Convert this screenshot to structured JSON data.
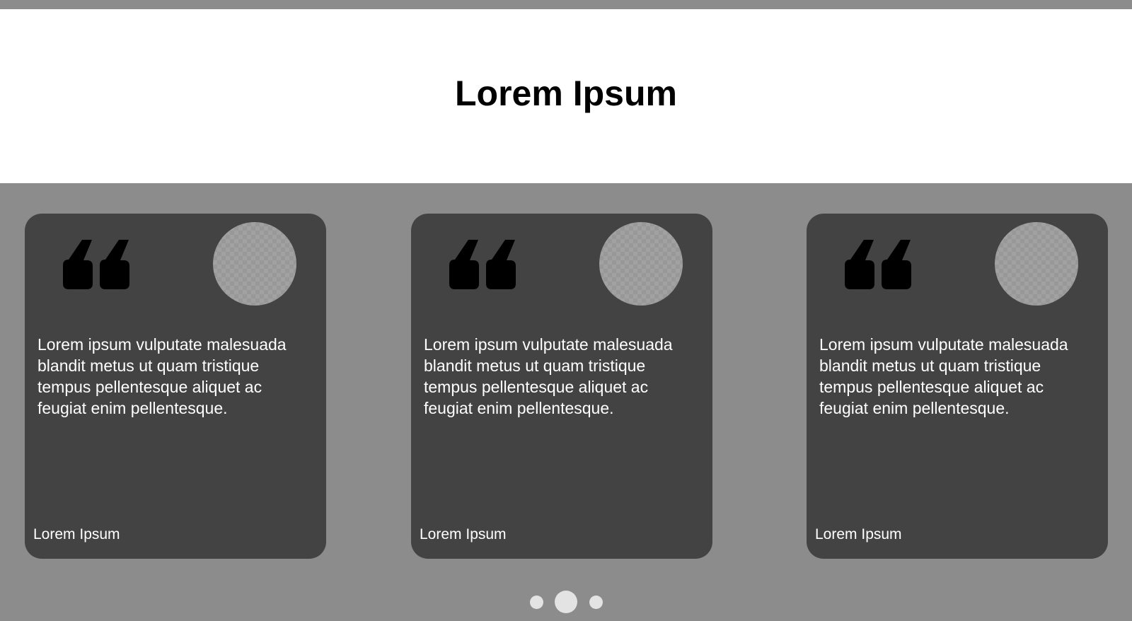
{
  "header": {
    "title": "Lorem Ipsum"
  },
  "testimonials": [
    {
      "quote": "Lorem ipsum vulputate malesuada blandit metus ut quam tristique tempus pellentesque aliquet ac feugiat enim pellentesque.",
      "author": "Lorem Ipsum",
      "icon": "quote-icon",
      "avatar": "avatar-placeholder"
    },
    {
      "quote": "Lorem ipsum vulputate malesuada blandit metus ut quam tristique tempus pellentesque aliquet ac feugiat enim pellentesque.",
      "author": "Lorem Ipsum",
      "icon": "quote-icon",
      "avatar": "avatar-placeholder"
    },
    {
      "quote": "Lorem ipsum vulputate malesuada blandit metus ut quam tristique tempus pellentesque aliquet ac feugiat enim pellentesque.",
      "author": "Lorem Ipsum",
      "icon": "quote-icon",
      "avatar": "avatar-placeholder"
    }
  ],
  "pagination": {
    "total": 3,
    "active": 2
  },
  "colors": {
    "band_bg": "#8c8c8c",
    "card_bg": "#434343",
    "avatar_placeholder": "#989898",
    "dot": "#e3e3e3",
    "title": "#000000",
    "card_text": "#ffffff"
  }
}
